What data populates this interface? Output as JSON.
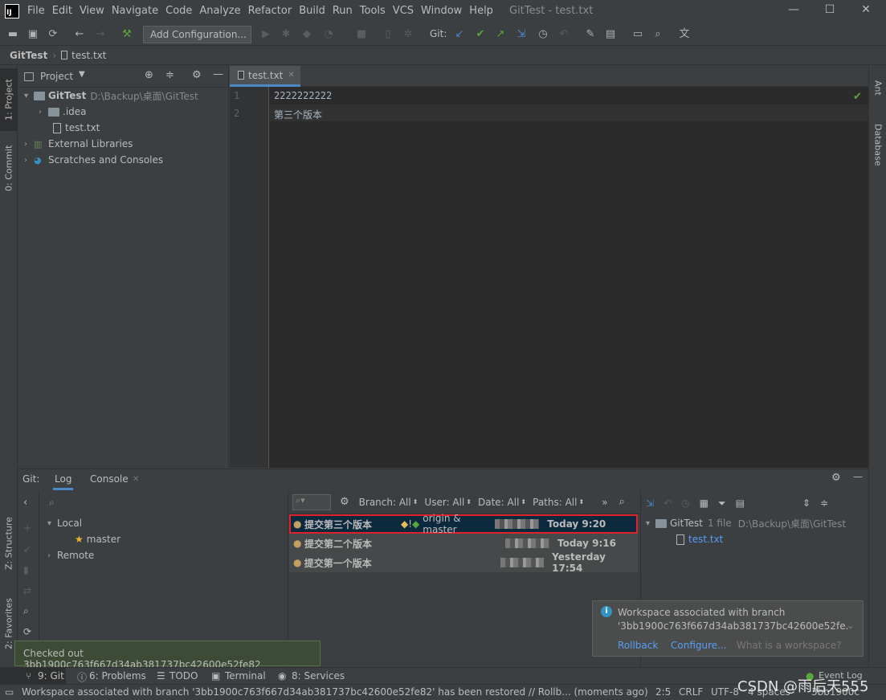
{
  "window": {
    "title": "GitTest - test.txt",
    "menu": [
      "File",
      "Edit",
      "View",
      "Navigate",
      "Code",
      "Analyze",
      "Refactor",
      "Build",
      "Run",
      "Tools",
      "VCS",
      "Window",
      "Help"
    ]
  },
  "toolbar": {
    "add_configuration": "Add Configuration...",
    "git_label": "Git:"
  },
  "breadcrumb": {
    "project": "GitTest",
    "file": "test.txt"
  },
  "left_stripe": {
    "project_tab": "1: Project",
    "commit_tab": "0: Commit",
    "structure_tab": "Z: Structure",
    "favorites_tab": "2: Favorites"
  },
  "right_stripe": {
    "ant_tab": "Ant",
    "database_tab": "Database"
  },
  "project_panel": {
    "title": "Project",
    "root_name": "GitTest",
    "root_path": "D:\\Backup\\桌面\\GitTest",
    "items": [
      ".idea",
      "test.txt",
      "External Libraries",
      "Scratches and Consoles"
    ]
  },
  "editor": {
    "tab_label": "test.txt",
    "lines": [
      {
        "num": "1",
        "text": "2222222222"
      },
      {
        "num": "2",
        "text": "第三个版本"
      }
    ]
  },
  "git_panel": {
    "label": "Git:",
    "tabs": [
      "Log",
      "Console"
    ],
    "branches": {
      "local": "Local",
      "master": "master",
      "remote": "Remote"
    },
    "filters": {
      "branch": "Branch: All",
      "user": "User: All",
      "date": "Date: All",
      "paths": "Paths: All"
    },
    "commits": [
      {
        "message": "提交第三个版本",
        "refs": "origin & master",
        "date": "Today 9:20"
      },
      {
        "message": "提交第二个版本",
        "refs": "",
        "date": "Today 9:16"
      },
      {
        "message": "提交第一个版本",
        "refs": "",
        "date": "Yesterday 17:54"
      }
    ],
    "details": {
      "root": "GitTest",
      "count": "1 file",
      "path": "D:\\Backup\\桌面\\GitTest",
      "file": "test.txt"
    }
  },
  "notification": {
    "text1": "Workspace associated with branch",
    "text2": "'3bb1900c763f667d34ab381737bc42600e52fe.",
    "rollback": "Rollback",
    "configure": "Configure...",
    "what": "What is a workspace?"
  },
  "toast": {
    "text": "Checked out 3bb1900c763f667d34ab381737bc42600e52fe82"
  },
  "tool_tabs": [
    "9: Git",
    "6: Problems",
    "TODO",
    "Terminal",
    "8: Services"
  ],
  "event_log": "Event Log",
  "status_bar": {
    "message": "Workspace associated with branch '3bb1900c763f667d34ab381737bc42600e52fe82' has been restored // Rollb... (moments ago)",
    "position": "2:5",
    "line_sep": "CRLF",
    "encoding": "UTF-8",
    "indent": "4 spaces",
    "branch": "3bb1900c"
  },
  "watermark": "CSDN @雨后天555",
  "colors": {
    "accent": "#4a88c7",
    "selection_border": "#e0202a",
    "link": "#589df6"
  }
}
